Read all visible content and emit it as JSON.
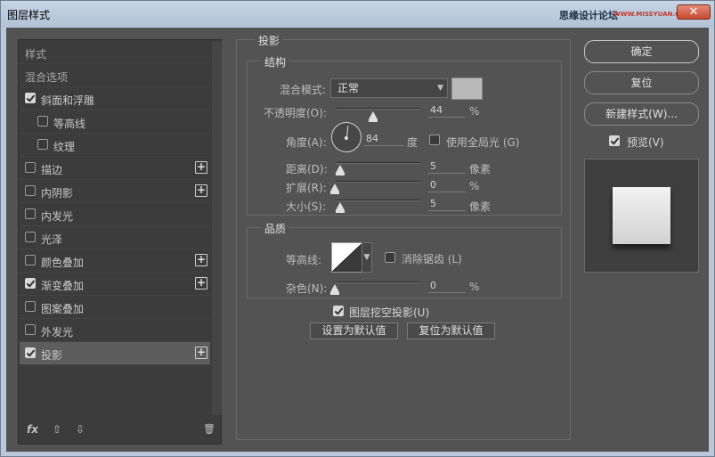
{
  "window": {
    "title": "图层样式",
    "watermark": "思缘设计论坛",
    "watermark_url": "WWW.MISSYUAN.COM",
    "close_icon": "close-icon"
  },
  "sidebar": {
    "items": [
      {
        "label": "样式",
        "checkbox": false,
        "checked": false,
        "plus": false
      },
      {
        "label": "混合选项",
        "checkbox": false,
        "checked": false,
        "plus": false
      },
      {
        "label": "斜面和浮雕",
        "checkbox": true,
        "checked": true,
        "plus": false
      },
      {
        "label": "等高线",
        "checkbox": true,
        "checked": false,
        "plus": false,
        "sub": true
      },
      {
        "label": "纹理",
        "checkbox": true,
        "checked": false,
        "plus": false,
        "sub": true
      },
      {
        "label": "描边",
        "checkbox": true,
        "checked": false,
        "plus": true
      },
      {
        "label": "内阴影",
        "checkbox": true,
        "checked": false,
        "plus": true
      },
      {
        "label": "内发光",
        "checkbox": true,
        "checked": false,
        "plus": false
      },
      {
        "label": "光泽",
        "checkbox": true,
        "checked": false,
        "plus": false
      },
      {
        "label": "颜色叠加",
        "checkbox": true,
        "checked": false,
        "plus": true
      },
      {
        "label": "渐变叠加",
        "checkbox": true,
        "checked": true,
        "plus": true
      },
      {
        "label": "图案叠加",
        "checkbox": true,
        "checked": false,
        "plus": false
      },
      {
        "label": "外发光",
        "checkbox": true,
        "checked": false,
        "plus": false
      },
      {
        "label": "投影",
        "checkbox": true,
        "checked": true,
        "plus": true,
        "selected": true
      }
    ],
    "plus_glyph": "+",
    "footer": {
      "fx": "fx",
      "up": "⇧",
      "down": "⇩",
      "trash": "🗑"
    }
  },
  "drop_shadow": {
    "title": "投影",
    "structure": {
      "title": "结构",
      "blend_mode_label": "混合模式:",
      "blend_mode_value": "正常",
      "shadow_color": "#b9b9b9",
      "opacity_label": "不透明度(O):",
      "opacity_value": "44",
      "opacity_unit": "%",
      "angle_label": "角度(A):",
      "angle_value": "84",
      "angle_unit": "度",
      "global_light_label": "使用全局光 (G)",
      "global_light_checked": false,
      "distance_label": "距离(D):",
      "distance_value": "5",
      "distance_unit": "像素",
      "spread_label": "扩展(R):",
      "spread_value": "0",
      "spread_unit": "%",
      "size_label": "大小(S):",
      "size_value": "5",
      "size_unit": "像素"
    },
    "quality": {
      "title": "品质",
      "contour_label": "等高线:",
      "anti_alias_label": "消除锯齿 (L)",
      "anti_alias_checked": false,
      "noise_label": "杂色(N):",
      "noise_value": "0",
      "noise_unit": "%"
    },
    "knockout_label": "图层挖空投影(U)",
    "knockout_checked": true,
    "make_default": "设置为默认值",
    "reset_default": "复位为默认值"
  },
  "buttons": {
    "ok": "确定",
    "reset": "复位",
    "new_style": "新建样式(W)...",
    "preview_label": "预览(V)",
    "preview_checked": true
  }
}
